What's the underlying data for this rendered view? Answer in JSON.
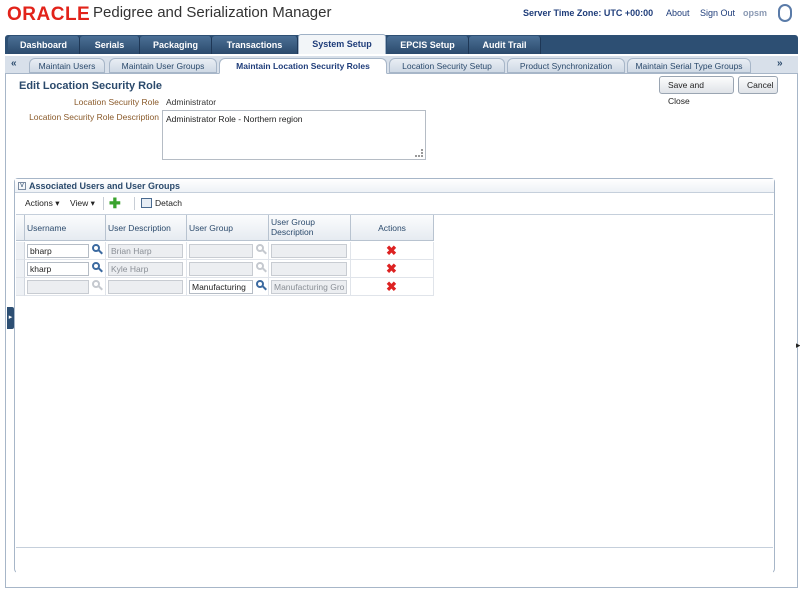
{
  "header": {
    "logo": "ORACLE",
    "app_title": "Pedigree and Serialization Manager",
    "server_time": "Server Time Zone: UTC +00:00",
    "about": "About",
    "sign_out": "Sign Out",
    "user": "opsm"
  },
  "main_tabs": [
    "Dashboard",
    "Serials",
    "Packaging",
    "Transactions",
    "System Setup",
    "EPCIS Setup",
    "Audit Trail"
  ],
  "main_tabs_active": "System Setup",
  "sub_tabs": [
    "Maintain Users",
    "Maintain User Groups",
    "Maintain Location Security Roles",
    "Location Security Setup",
    "Product Synchronization",
    "Maintain Serial Type Groups"
  ],
  "sub_tabs_active": "Maintain Location Security Roles",
  "page": {
    "title": "Edit Location Security Role",
    "save_close": "Save and Close",
    "cancel": "Cancel",
    "role_label": "Location Security Role",
    "role_value": "Administrator",
    "desc_label": "Location Security Role Description",
    "desc_value": "Administrator Role - Northern region"
  },
  "panel": {
    "title": "Associated Users and User Groups",
    "actions_menu": "Actions",
    "view_menu": "View",
    "detach": "Detach",
    "columns": {
      "username": "Username",
      "user_description": "User Description",
      "user_group": "User Group",
      "user_group_desc_1": "User Group",
      "user_group_desc_2": "Description",
      "actions": "Actions"
    },
    "rows": [
      {
        "username": "bharp",
        "user_description": "Brian Harp",
        "user_group": "",
        "user_group_description": ""
      },
      {
        "username": "kharp",
        "user_description": "Kyle Harp",
        "user_group": "",
        "user_group_description": ""
      },
      {
        "username": "",
        "user_description": "",
        "user_group": "Manufacturing",
        "user_group_description": "Manufacturing Gro"
      }
    ]
  },
  "colors": {
    "brand_red": "#e2231a",
    "nav_blue": "#2d4f73",
    "link_blue": "#1f3d7a",
    "delete_red": "#dd2222",
    "add_green": "#3aa32e"
  }
}
